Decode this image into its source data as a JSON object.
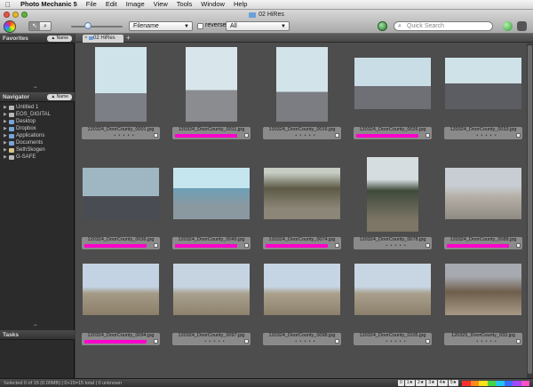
{
  "menubar": {
    "app": "Photo Mechanic 5",
    "items": [
      "File",
      "Edit",
      "Image",
      "View",
      "Tools",
      "Window",
      "Help"
    ]
  },
  "window": {
    "title": "02 HiRes"
  },
  "toolbar": {
    "sort_field": "Filename",
    "reverse_label": "reverse",
    "filter": "All",
    "search_placeholder": "Quick Search"
  },
  "sidebar": {
    "favorites": {
      "title": "Favorites",
      "button": "Name"
    },
    "navigator": {
      "title": "Navigator",
      "button": "Name",
      "items": [
        "Untitled 1",
        "EOS_DIGITAL",
        "Desktop",
        "Dropbox",
        "Applications",
        "Documents",
        "SethSkogen",
        "G-SAFE"
      ]
    },
    "tasks": {
      "title": "Tasks"
    }
  },
  "tabs": [
    {
      "label": "02 HiRes"
    }
  ],
  "thumbnails": [
    {
      "filename": "120324_DoorCounty_0001.jpg",
      "tagged": false
    },
    {
      "filename": "120324_DoorCounty_0011.jpg",
      "tagged": true
    },
    {
      "filename": "120324_DoorCounty_0016.jpg",
      "tagged": false
    },
    {
      "filename": "120324_DoorCounty_0026.jpg",
      "tagged": true
    },
    {
      "filename": "120324_DoorCounty_0033.jpg",
      "tagged": false
    },
    {
      "filename": "120324_DoorCounty_0036.jpg",
      "tagged": true
    },
    {
      "filename": "120324_DoorCounty_0049.jpg",
      "tagged": true
    },
    {
      "filename": "120324_DoorCounty_0074.jpg",
      "tagged": true
    },
    {
      "filename": "120324_DoorCounty_0078.jpg",
      "tagged": false
    },
    {
      "filename": "120324_DoorCounty_0088.jpg",
      "tagged": true
    },
    {
      "filename": "120324_DoorCounty_0094.jpg",
      "tagged": true
    },
    {
      "filename": "120324_DoorCounty_0097.jpg",
      "tagged": false
    },
    {
      "filename": "120324_DoorCounty_0098.jpg",
      "tagged": false
    },
    {
      "filename": "120324_DoorCounty_0105.jpg",
      "tagged": false
    },
    {
      "filename": "120325_DoorCounty_033.jpg",
      "tagged": false
    }
  ],
  "star_placeholder": "• • • • •",
  "statusbar": {
    "text": "Selected 0 of 15 (0.00MB)  |  0+15=15 total  |  0 unknown",
    "ratings": [
      "0",
      "1★",
      "2★",
      "3★",
      "4★",
      "5★"
    ]
  },
  "colors": {
    "accent": "#ff00cc",
    "color_classes": [
      "#ff2d2d",
      "#ff8c1a",
      "#ffe11a",
      "#43d43f",
      "#25c4f0",
      "#3b6cff",
      "#a646ff",
      "#ff4fc6"
    ]
  }
}
